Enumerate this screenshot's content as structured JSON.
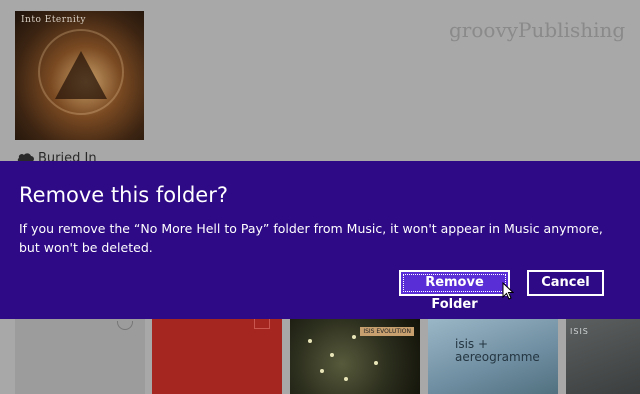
{
  "watermark": "groovyPublishing",
  "background": {
    "album": {
      "band": "Into Eternity"
    },
    "item_label": "Buried In"
  },
  "dialog": {
    "title": "Remove this folder?",
    "message": "If you remove the “No More Hell to Pay” folder from Music, it won't appear in Music anymore, but won't be deleted.",
    "buttons": {
      "remove": "Remove Folder",
      "cancel": "Cancel"
    }
  },
  "thumbnails": [
    {
      "text": ""
    },
    {
      "text": ""
    },
    {
      "text": "ISIS EVOLUTION"
    },
    {
      "text": "isis + aereogramme"
    },
    {
      "text": "ISIS"
    }
  ],
  "colors": {
    "dialog_bg": "#2e0a86",
    "primary_button": "#5a2ed6",
    "text": "#ffffff"
  }
}
